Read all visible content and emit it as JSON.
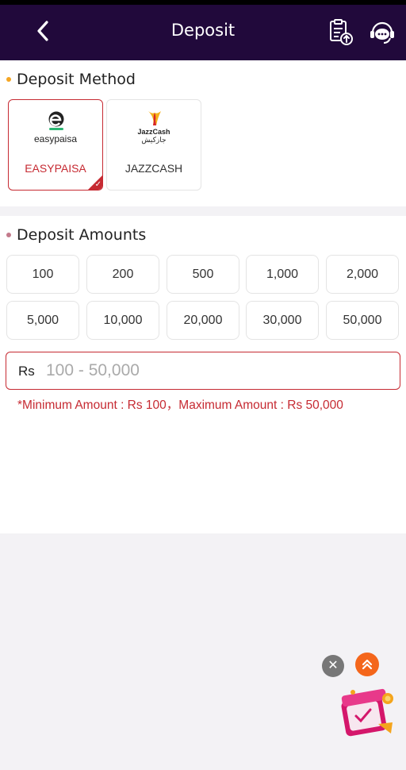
{
  "header": {
    "title": "Deposit",
    "back_icon": "chevron-left-icon",
    "history_icon": "clipboard-upload-icon",
    "support_icon": "support-chat-icon",
    "background": "#21093b"
  },
  "deposit_method": {
    "title": "Deposit Method",
    "dot_color": "#f5a623",
    "methods": [
      {
        "brand": "easypaisa",
        "label": "EASYPAISA",
        "selected": true
      },
      {
        "brand_line1": "JazzCash",
        "brand_line2": "جازکیش",
        "label": "JAZZCASH",
        "selected": false
      }
    ]
  },
  "deposit_amounts": {
    "title": "Deposit Amounts",
    "dot_color": "#c37a8c",
    "amounts": [
      "100",
      "200",
      "500",
      "1,000",
      "2,000",
      "5,000",
      "10,000",
      "20,000",
      "30,000",
      "50,000"
    ]
  },
  "amount_input": {
    "currency": "Rs",
    "placeholder": "100 - 50,000",
    "value": ""
  },
  "limit_note": "*Minimum Amount : Rs 100，Maximum Amount : Rs 50,000",
  "floating": {
    "close_icon": "close-icon",
    "scroll_up_icon": "double-chevron-up-icon",
    "promo_icon": "gift-box-icon"
  },
  "colors": {
    "accent": "#c62a32",
    "easypaisa_green": "#2bb673"
  }
}
